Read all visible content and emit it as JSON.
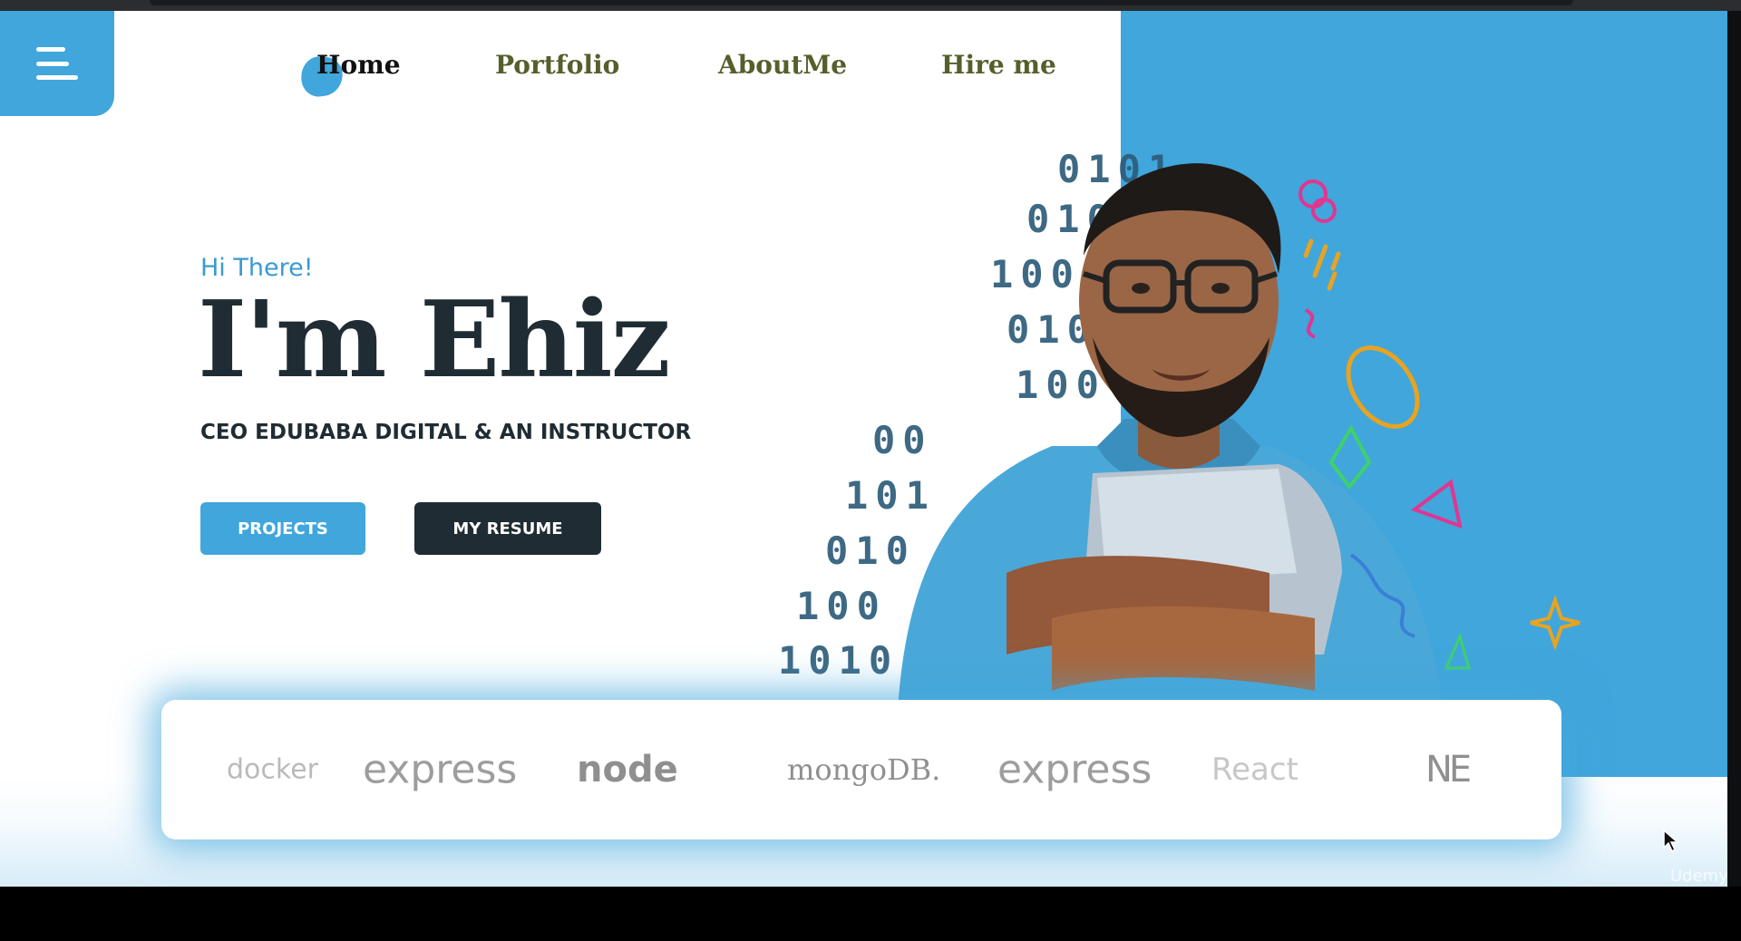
{
  "nav": {
    "items": [
      {
        "label": "Home",
        "active": true
      },
      {
        "label": "Portfolio",
        "active": false
      },
      {
        "label": "AboutMe",
        "active": false
      },
      {
        "label": "Hire me",
        "active": false
      }
    ]
  },
  "hero": {
    "greeting": "Hi There!",
    "headline": "I'm Ehiz",
    "subtitle": "CEO EDUBABA DIGITAL & AN INSTRUCTOR",
    "primary_button": "PROJECTS",
    "secondary_button": "MY RESUME"
  },
  "binary_lines": [
    "0101",
    "010",
    "1001",
    "010",
    "100",
    "00",
    "101",
    "010",
    "100",
    "1010"
  ],
  "tech_logos": {
    "docker": "docker",
    "express_1": "express",
    "node": "node",
    "mongodb": "mongoDB.",
    "express_2": "express",
    "react": "React",
    "next": "NE"
  },
  "watermark": "Udemy",
  "colors": {
    "accent_blue": "#40a6dc",
    "dark": "#1f2c33",
    "nav_olive": "#555f2b"
  }
}
